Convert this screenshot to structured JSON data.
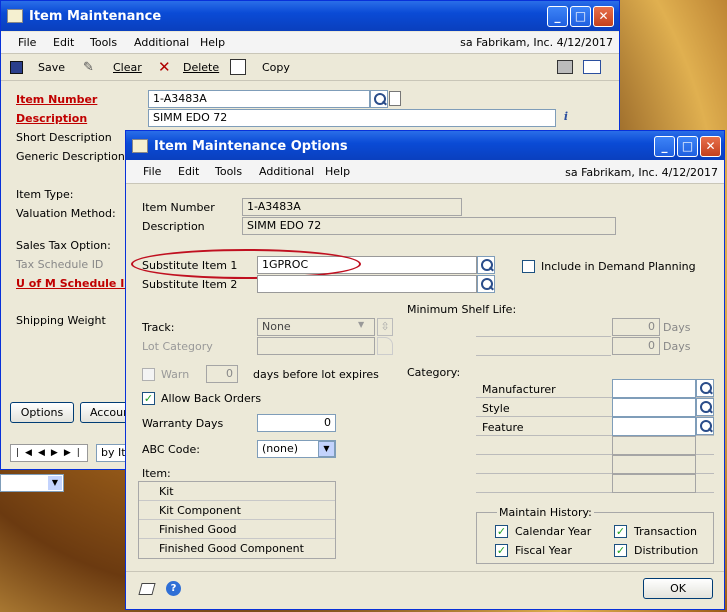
{
  "back": {
    "title": "Item Maintenance",
    "menu": [
      "File",
      "Edit",
      "Tools",
      "Additional",
      "Help"
    ],
    "company": "sa  Fabrikam, Inc.  4/12/2017",
    "toolbar": {
      "save": "Save",
      "clear": "Clear",
      "delete": "Delete",
      "copy": "Copy"
    },
    "labels": {
      "item_number": "Item Number",
      "description": "Description",
      "short_description": "Short Description",
      "generic_description": "Generic Description",
      "item_type": "Item Type:",
      "valuation_method": "Valuation Method:",
      "sales_tax_option": "Sales Tax Option:",
      "tax_schedule_id": "Tax Schedule ID",
      "u_of_m": "U of M Schedule ID",
      "shipping_weight": "Shipping Weight"
    },
    "item_number": "1-A3483A",
    "description": "SIMM EDO 72",
    "options_btn": "Options",
    "account_btn": "Accoun",
    "sort_by": "by Ite"
  },
  "front": {
    "title": "Item Maintenance Options",
    "menu": [
      "File",
      "Edit",
      "Tools",
      "Additional",
      "Help"
    ],
    "company": "sa  Fabrikam, Inc.  4/12/2017",
    "labels": {
      "item_number": "Item Number",
      "description": "Description",
      "sub1": "Substitute Item 1",
      "sub2": "Substitute Item 2",
      "track": "Track:",
      "lot_category": "Lot Category",
      "warn": "Warn",
      "days_before": "days before lot expires",
      "allow_back_orders": "Allow Back Orders",
      "warranty_days": "Warranty Days",
      "abc_code": "ABC Code:",
      "item": "Item:",
      "include_demand": "Include in Demand Planning",
      "min_shelf": "Minimum Shelf Life:",
      "days": "Days",
      "category": "Category:",
      "maintain_history": "Maintain History:"
    },
    "item_number": "1-A3483A",
    "description": "SIMM EDO 72",
    "sub1_value": "1GPROC",
    "sub2_value": "",
    "track_value": "None",
    "warn_days": "0",
    "warranty_days": "0",
    "abc_value": "(none)",
    "shelf_days_1": "0",
    "shelf_days_2": "0",
    "item_list": [
      "Kit",
      "Kit Component",
      "Finished Good",
      "Finished Good Component"
    ],
    "categories": [
      "Manufacturer",
      "Style",
      "Feature"
    ],
    "history": {
      "calendar_year": "Calendar Year",
      "transaction": "Transaction",
      "fiscal_year": "Fiscal Year",
      "distribution": "Distribution"
    },
    "ok": "OK"
  }
}
